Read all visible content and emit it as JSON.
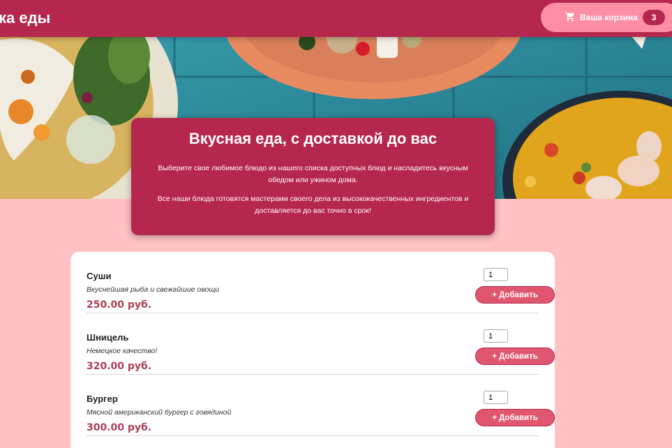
{
  "header": {
    "logo": "ка еды",
    "cart_label": "Ваша корзина",
    "cart_count": "3",
    "cart_icon": "cart-icon"
  },
  "summary": {
    "title": "Вкусная еда, с доставкой до вас",
    "text1": "Выберите свое любимое блюдо из нашего списка доступных блюд и насладитесь вкусным обедом или ужином дома.",
    "text2": "Все наши блюда готовятся мастерами своего дела из высококачественных ингредиентов и доставляется до вас точно в срок!"
  },
  "meals": [
    {
      "name": "Суши",
      "description": "Вкуснейшая рыба и свежайшие овощи",
      "price": "250.00 руб.",
      "qty": "1",
      "add_label": "+ Добавить"
    },
    {
      "name": "Шницель",
      "description": "Немецкое качество!",
      "price": "320.00 руб.",
      "qty": "1",
      "add_label": "+ Добавить"
    },
    {
      "name": "Бургер",
      "description": "Мясной американский бургер с говядиной",
      "price": "300.00 руб.",
      "qty": "1",
      "add_label": "+ Добавить"
    }
  ],
  "colors": {
    "header": "#b5274d",
    "cart_button": "#fd8ea4",
    "background": "#ffc1c1",
    "price": "#ad3e56",
    "add_button": "#e0566f"
  }
}
